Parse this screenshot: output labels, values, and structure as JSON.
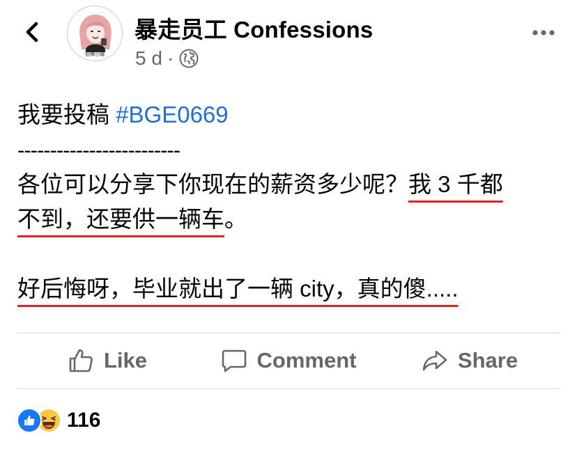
{
  "header": {
    "page_name": "暴走员工 Confessions",
    "timestamp": "5 d",
    "separator": "·",
    "privacy_icon": "globe-icon",
    "back_icon": "chevron-left-icon",
    "more_icon": "more-horizontal-icon",
    "avatar_caption": "投稿小编"
  },
  "post": {
    "line1_text": "我要投稿 ",
    "line1_hashtag": "#BGE0669",
    "line2_separator": "-------------------------",
    "line3_plain": "各位可以分享下你现在的薪资多少呢？",
    "line3_underlined": "我 3 千都",
    "line4_underlined": "不到，还要供一辆车",
    "line4_tail": "。",
    "line5_underlined": "好后悔呀，毕业就出了一辆 city，真的傻....."
  },
  "actions": {
    "like_label": "Like",
    "like_icon": "thumbs-up-icon",
    "comment_label": "Comment",
    "comment_icon": "comment-bubble-icon",
    "share_label": "Share",
    "share_icon": "share-arrow-icon"
  },
  "reactions": {
    "count": "116",
    "types": [
      "like-reaction-icon",
      "haha-reaction-icon"
    ]
  },
  "colors": {
    "hashtag": "#1f6fd8",
    "underline": "#e02020",
    "muted_text": "#65676b",
    "like_blue": "#1877f2",
    "haha_yellow": "#f7c843"
  }
}
